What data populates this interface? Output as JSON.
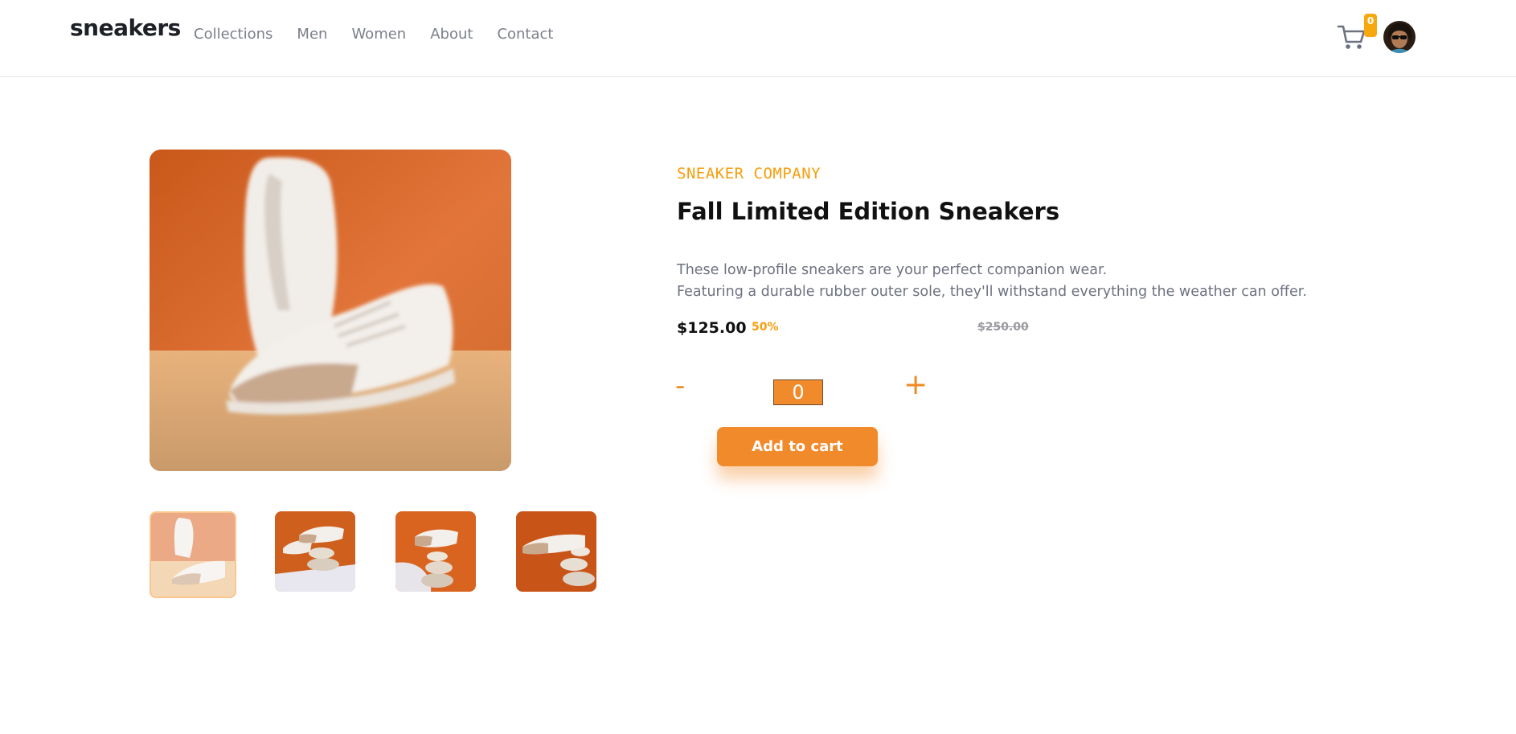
{
  "header": {
    "logo": "sneakers",
    "nav": [
      "Collections",
      "Men",
      "Women",
      "About",
      "Contact"
    ],
    "cart_count": "0"
  },
  "product": {
    "company": "SNEAKER COMPANY",
    "title": "Fall Limited Edition Sneakers",
    "description_line1": "These low-profile sneakers are your perfect companion wear.",
    "description_line2": "Featuring a durable rubber outer sole, they'll withstand everything the weather can offer.",
    "price": "$125.00",
    "discount": "50%",
    "old_price": "$250.00",
    "minus_label": "-",
    "quantity": "0",
    "plus_label": "+",
    "add_to_cart_label": "Add to cart"
  },
  "colors": {
    "accent": "#f18a2b",
    "badge": "#f7a80f",
    "company_text": "#f59e0b"
  },
  "icons": [
    "cart-icon",
    "avatar"
  ]
}
